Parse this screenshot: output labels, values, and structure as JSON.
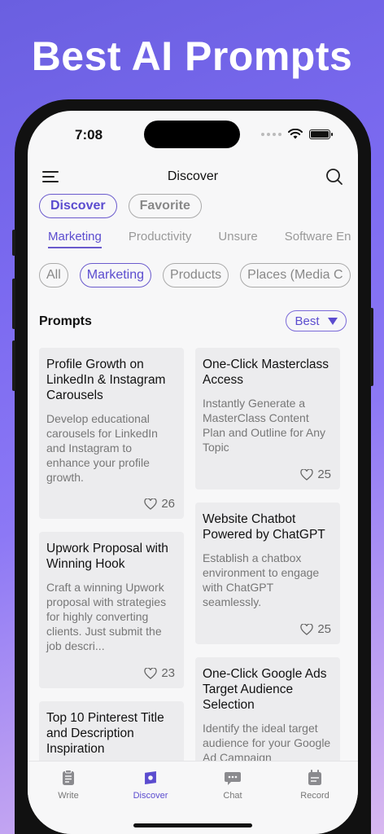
{
  "hero": {
    "title": "Best AI Prompts"
  },
  "status": {
    "time": "7:08"
  },
  "nav": {
    "title": "Discover"
  },
  "toggles": [
    {
      "label": "Discover",
      "active": true
    },
    {
      "label": "Favorite",
      "active": false
    }
  ],
  "categories": [
    {
      "label": "Marketing",
      "active": true
    },
    {
      "label": "Productivity",
      "active": false
    },
    {
      "label": "Unsure",
      "active": false
    },
    {
      "label": "Software En",
      "active": false
    }
  ],
  "filters": [
    {
      "label": "All",
      "active": false
    },
    {
      "label": "Marketing",
      "active": true
    },
    {
      "label": "Products",
      "active": false
    },
    {
      "label": "Places (Media C",
      "active": false
    }
  ],
  "prompts": {
    "label": "Prompts",
    "sort": "Best"
  },
  "cards": [
    {
      "title": "Profile Growth on LinkedIn & Instagram Carousels",
      "desc": "Develop educational carousels for LinkedIn and Instagram to enhance your profile growth.",
      "likes": "26"
    },
    {
      "title": "One-Click Masterclass Access",
      "desc": "Instantly Generate a MasterClass Content Plan and Outline for Any Topic",
      "likes": "25"
    },
    {
      "title": "Upwork Proposal with Winning Hook",
      "desc": "Craft a winning Upwork proposal with strategies for highly converting clients. Just submit the job descri...",
      "likes": "23"
    },
    {
      "title": "Website Chatbot Powered by ChatGPT",
      "desc": "Establish a chatbox environment to engage with ChatGPT seamlessly.",
      "likes": "25"
    },
    {
      "title": "Top 10 Pinterest Title and Description Inspiration",
      "desc": "",
      "likes": ""
    },
    {
      "title": "One-Click Google Ads Target Audience Selection",
      "desc": "Identify the ideal target audience for your Google Ad Campaign",
      "likes": ""
    }
  ],
  "tabbar": [
    {
      "label": "Write",
      "icon": "clipboard-icon",
      "active": false
    },
    {
      "label": "Discover",
      "icon": "compass-icon",
      "active": true
    },
    {
      "label": "Chat",
      "icon": "chat-bubble-icon",
      "active": false
    },
    {
      "label": "Record",
      "icon": "record-icon",
      "active": false
    }
  ],
  "colors": {
    "accent": "#5b4ccf",
    "background": "#7b6af0"
  }
}
